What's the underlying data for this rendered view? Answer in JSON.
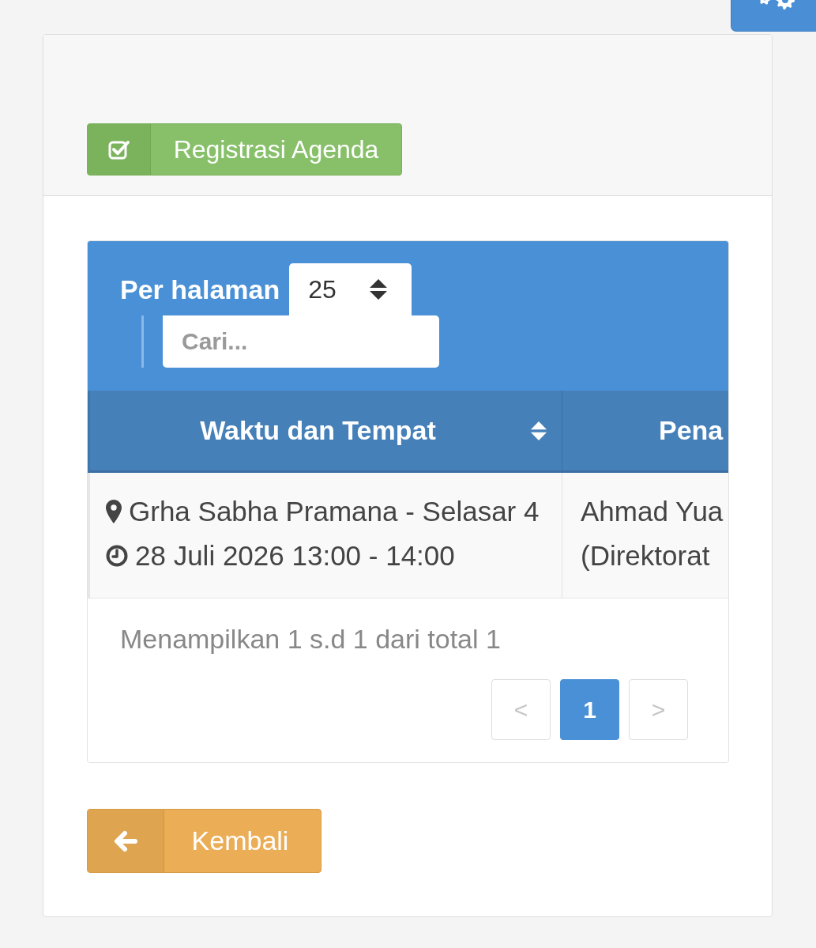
{
  "register_button": {
    "label": "Registrasi Agenda"
  },
  "table": {
    "per_page_label": "Per halaman",
    "per_page_value": "25",
    "search": {
      "placeholder": "Cari..."
    },
    "columns": [
      {
        "label": "Waktu dan Tempat",
        "sortable": true
      },
      {
        "label": "Pena",
        "sortable": false
      }
    ],
    "rows": [
      {
        "cells": [
          {
            "lines": [
              {
                "kind": "place",
                "text": "Grha Sabha Pramana - Selasar 4"
              },
              {
                "kind": "time",
                "text": "28 Juli 2026 13:00 - 14:00"
              }
            ]
          },
          {
            "lines": [
              {
                "kind": "text",
                "text": "Ahmad Yua"
              },
              {
                "kind": "text",
                "text": "(Direktorat"
              }
            ]
          }
        ]
      }
    ],
    "summary": "Menampilkan 1 s.d 1 dari total 1",
    "pagination": [
      {
        "label": "<",
        "selected": false,
        "disabled": true
      },
      {
        "label": "1",
        "selected": true,
        "disabled": false
      },
      {
        "label": ">",
        "selected": false,
        "disabled": true
      }
    ]
  },
  "back_button": {
    "label": "Kembali"
  }
}
